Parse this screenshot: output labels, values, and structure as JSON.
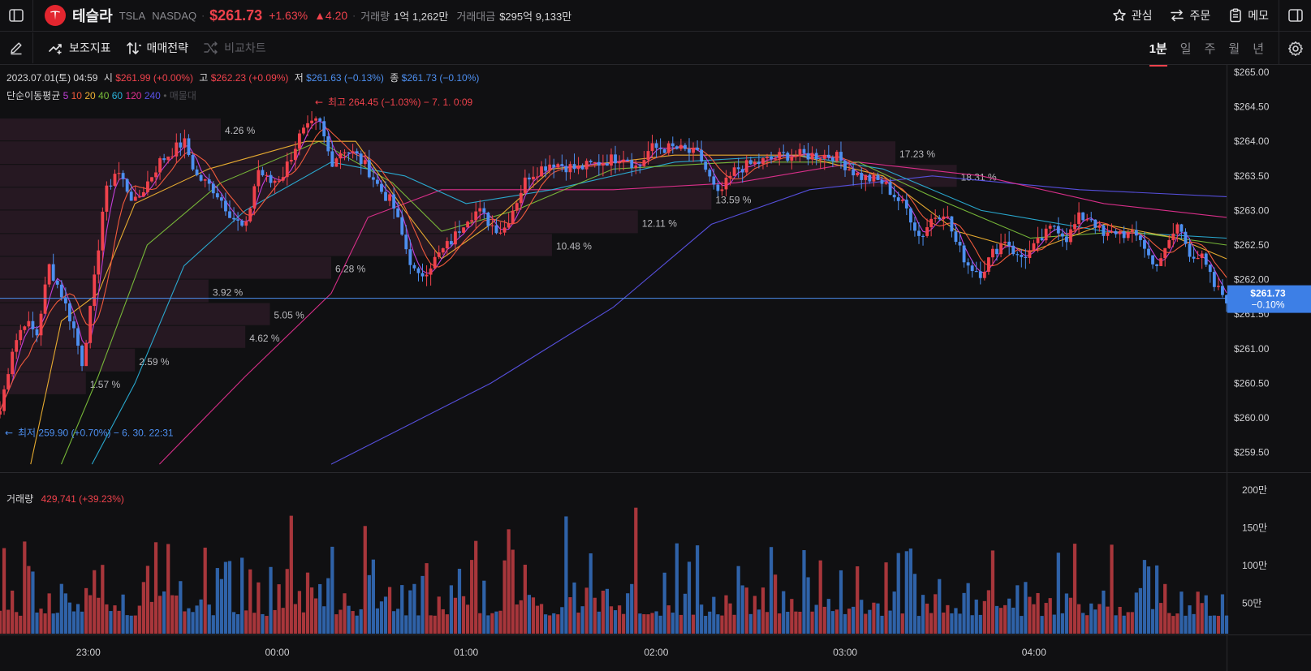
{
  "header": {
    "stock_name": "테슬라",
    "ticker": "TSLA",
    "exchange": "NASDAQ",
    "price": "$261.73",
    "change_pct": "+1.63%",
    "change_abs": "▲4.20",
    "volume_label": "거래량",
    "volume_value": "1억 1,262만",
    "amount_label": "거래대금",
    "amount_value": "$295억 9,133만",
    "actions": [
      "관심",
      "주문",
      "메모"
    ]
  },
  "toolbar": {
    "indicators_label": "보조지표",
    "strategy_label": "매매전략",
    "compare_label": "비교차트",
    "periods": [
      "1분",
      "일",
      "주",
      "월",
      "년"
    ],
    "active_period": "1분"
  },
  "ohlc": {
    "datetime": "2023.07.01(토) 04:59",
    "open_label": "시",
    "open": "$261.99 (+0.00%)",
    "high_label": "고",
    "high": "$262.23 (+0.09%)",
    "low_label": "저",
    "low": "$261.63 (−0.13%)",
    "close_label": "종",
    "close": "$261.73 (−0.10%)"
  },
  "ma": {
    "label": "단순이동평균",
    "periods": [
      {
        "p": "5",
        "color": "#c23fd8"
      },
      {
        "p": "10",
        "color": "#f05a3c"
      },
      {
        "p": "20",
        "color": "#f0b232"
      },
      {
        "p": "40",
        "color": "#7bbf3a"
      },
      {
        "p": "60",
        "color": "#2ab0d8"
      },
      {
        "p": "120",
        "color": "#e3308f"
      },
      {
        "p": "240",
        "color": "#5a52e6"
      }
    ],
    "extra": "매물대"
  },
  "volume_info": {
    "label": "거래량",
    "value": "429,741 (+39.23%)"
  },
  "chart_data": {
    "type": "candlestick",
    "price_axis": [
      "$265.00",
      "$264.50",
      "$264.00",
      "$263.50",
      "$263.00",
      "$262.50",
      "$262.00",
      "$261.50",
      "$261.00",
      "$260.50",
      "$260.00",
      "$259.50"
    ],
    "ylim": [
      259.33,
      265.0
    ],
    "volume_axis": [
      "200만",
      "150만",
      "100만",
      "50만"
    ],
    "volume_max": 2000000,
    "time_labels": [
      {
        "t": "23:00",
        "frac": 0.072
      },
      {
        "t": "00:00",
        "frac": 0.226
      },
      {
        "t": "01:00",
        "frac": 0.38
      },
      {
        "t": "02:00",
        "frac": 0.535
      },
      {
        "t": "03:00",
        "frac": 0.689
      },
      {
        "t": "04:00",
        "frac": 0.843
      }
    ],
    "current_price": {
      "value": 261.73,
      "label": "$261.73",
      "pct": "−0.10%"
    },
    "high_marker": {
      "value": 264.45,
      "text": "최고 264.45 (−1.03%) − 7. 1. 0:09"
    },
    "low_marker": {
      "value": 259.9,
      "text": "최저 259.90 (+0.70%) − 6. 30. 22:31"
    },
    "volume_profile": [
      {
        "pct": "4.26 %",
        "lo": 264.0,
        "hi": 264.33,
        "frac": 0.18
      },
      {
        "pct": "17.23 %",
        "lo": 263.66,
        "hi": 264.0,
        "frac": 0.73
      },
      {
        "pct": "18.31 %",
        "lo": 263.33,
        "hi": 263.66,
        "frac": 0.78
      },
      {
        "pct": "13.59 %",
        "lo": 263.0,
        "hi": 263.33,
        "frac": 0.58
      },
      {
        "pct": "12.11 %",
        "lo": 262.66,
        "hi": 263.0,
        "frac": 0.52
      },
      {
        "pct": "10.48 %",
        "lo": 262.33,
        "hi": 262.66,
        "frac": 0.45
      },
      {
        "pct": "6.28 %",
        "lo": 262.0,
        "hi": 262.33,
        "frac": 0.27
      },
      {
        "pct": "3.92 %",
        "lo": 261.66,
        "hi": 262.0,
        "frac": 0.17
      },
      {
        "pct": "5.05 %",
        "lo": 261.33,
        "hi": 261.66,
        "frac": 0.22
      },
      {
        "pct": "4.62 %",
        "lo": 261.0,
        "hi": 261.33,
        "frac": 0.2
      },
      {
        "pct": "2.59 %",
        "lo": 260.66,
        "hi": 261.0,
        "frac": 0.11
      },
      {
        "pct": "1.57 %",
        "lo": 260.33,
        "hi": 260.66,
        "frac": 0.07
      }
    ],
    "close_path": [
      [
        0.0,
        260.1
      ],
      [
        0.01,
        261.0
      ],
      [
        0.02,
        261.4
      ],
      [
        0.03,
        261.2
      ],
      [
        0.04,
        262.2
      ],
      [
        0.05,
        261.8
      ],
      [
        0.06,
        261.3
      ],
      [
        0.067,
        260.8
      ],
      [
        0.075,
        261.7
      ],
      [
        0.085,
        263.2
      ],
      [
        0.095,
        263.6
      ],
      [
        0.11,
        263.1
      ],
      [
        0.13,
        263.7
      ],
      [
        0.15,
        264.0
      ],
      [
        0.16,
        263.5
      ],
      [
        0.175,
        263.3
      ],
      [
        0.19,
        262.9
      ],
      [
        0.2,
        262.7
      ],
      [
        0.21,
        263.6
      ],
      [
        0.22,
        263.4
      ],
      [
        0.23,
        263.5
      ],
      [
        0.245,
        264.1
      ],
      [
        0.26,
        264.3
      ],
      [
        0.27,
        263.7
      ],
      [
        0.28,
        263.9
      ],
      [
        0.29,
        263.8
      ],
      [
        0.3,
        263.6
      ],
      [
        0.31,
        263.3
      ],
      [
        0.32,
        263.1
      ],
      [
        0.33,
        262.5
      ],
      [
        0.34,
        262.0
      ],
      [
        0.35,
        262.2
      ],
      [
        0.36,
        262.4
      ],
      [
        0.37,
        262.6
      ],
      [
        0.38,
        262.9
      ],
      [
        0.39,
        263.0
      ],
      [
        0.4,
        262.8
      ],
      [
        0.41,
        262.7
      ],
      [
        0.42,
        263.1
      ],
      [
        0.43,
        263.5
      ],
      [
        0.45,
        263.7
      ],
      [
        0.47,
        263.6
      ],
      [
        0.49,
        263.7
      ],
      [
        0.51,
        263.8
      ],
      [
        0.52,
        263.6
      ],
      [
        0.53,
        263.9
      ],
      [
        0.55,
        263.9
      ],
      [
        0.57,
        263.8
      ],
      [
        0.585,
        263.2
      ],
      [
        0.6,
        263.6
      ],
      [
        0.62,
        263.7
      ],
      [
        0.64,
        263.8
      ],
      [
        0.66,
        263.8
      ],
      [
        0.68,
        263.8
      ],
      [
        0.7,
        263.5
      ],
      [
        0.72,
        263.4
      ],
      [
        0.74,
        263.0
      ],
      [
        0.75,
        262.6
      ],
      [
        0.76,
        262.9
      ],
      [
        0.77,
        263.0
      ],
      [
        0.78,
        262.5
      ],
      [
        0.79,
        262.2
      ],
      [
        0.8,
        262.1
      ],
      [
        0.81,
        262.4
      ],
      [
        0.82,
        262.6
      ],
      [
        0.83,
        262.3
      ],
      [
        0.84,
        262.4
      ],
      [
        0.85,
        262.6
      ],
      [
        0.86,
        262.8
      ],
      [
        0.87,
        262.6
      ],
      [
        0.88,
        262.9
      ],
      [
        0.89,
        262.9
      ],
      [
        0.9,
        262.6
      ],
      [
        0.91,
        262.7
      ],
      [
        0.93,
        262.6
      ],
      [
        0.94,
        262.2
      ],
      [
        0.95,
        262.4
      ],
      [
        0.96,
        262.8
      ],
      [
        0.97,
        262.4
      ],
      [
        0.98,
        262.3
      ],
      [
        0.99,
        261.9
      ],
      [
        1.0,
        261.73
      ]
    ],
    "ma_paths": [
      {
        "period": "240",
        "points": [
          [
            0.27,
            259.33
          ],
          [
            0.4,
            260.5
          ],
          [
            0.5,
            261.6
          ],
          [
            0.58,
            262.8
          ],
          [
            0.66,
            263.3
          ],
          [
            0.76,
            263.5
          ],
          [
            0.88,
            263.3
          ],
          [
            1.0,
            263.2
          ]
        ]
      },
      {
        "period": "120",
        "points": [
          [
            0.13,
            259.33
          ],
          [
            0.2,
            260.6
          ],
          [
            0.27,
            261.8
          ],
          [
            0.3,
            262.9
          ],
          [
            0.36,
            263.3
          ],
          [
            0.5,
            263.3
          ],
          [
            0.6,
            263.4
          ],
          [
            0.7,
            263.7
          ],
          [
            0.8,
            263.5
          ],
          [
            0.9,
            263.1
          ],
          [
            1.0,
            262.9
          ]
        ]
      },
      {
        "period": "60",
        "points": [
          [
            0.075,
            259.33
          ],
          [
            0.11,
            260.5
          ],
          [
            0.15,
            262.2
          ],
          [
            0.2,
            263.0
          ],
          [
            0.27,
            263.7
          ],
          [
            0.33,
            263.5
          ],
          [
            0.38,
            263.1
          ],
          [
            0.45,
            263.3
          ],
          [
            0.55,
            263.7
          ],
          [
            0.65,
            263.8
          ],
          [
            0.72,
            263.6
          ],
          [
            0.8,
            263.0
          ],
          [
            0.9,
            262.7
          ],
          [
            1.0,
            262.6
          ]
        ]
      },
      {
        "period": "40",
        "points": [
          [
            0.05,
            259.33
          ],
          [
            0.08,
            260.6
          ],
          [
            0.12,
            262.5
          ],
          [
            0.18,
            263.4
          ],
          [
            0.26,
            264.0
          ],
          [
            0.32,
            263.4
          ],
          [
            0.36,
            262.7
          ],
          [
            0.42,
            263.0
          ],
          [
            0.5,
            263.6
          ],
          [
            0.6,
            263.7
          ],
          [
            0.7,
            263.7
          ],
          [
            0.76,
            263.2
          ],
          [
            0.84,
            262.6
          ],
          [
            0.92,
            262.7
          ],
          [
            1.0,
            262.5
          ]
        ]
      },
      {
        "period": "20",
        "points": [
          [
            0.025,
            259.33
          ],
          [
            0.05,
            261.4
          ],
          [
            0.08,
            261.8
          ],
          [
            0.11,
            263.1
          ],
          [
            0.17,
            263.6
          ],
          [
            0.25,
            264.0
          ],
          [
            0.29,
            264.0
          ],
          [
            0.33,
            263.0
          ],
          [
            0.36,
            262.3
          ],
          [
            0.4,
            262.8
          ],
          [
            0.45,
            263.6
          ],
          [
            0.55,
            263.8
          ],
          [
            0.65,
            263.8
          ],
          [
            0.72,
            263.5
          ],
          [
            0.78,
            262.7
          ],
          [
            0.84,
            262.4
          ],
          [
            0.9,
            262.8
          ],
          [
            0.96,
            262.6
          ],
          [
            1.0,
            262.3
          ]
        ]
      }
    ]
  }
}
